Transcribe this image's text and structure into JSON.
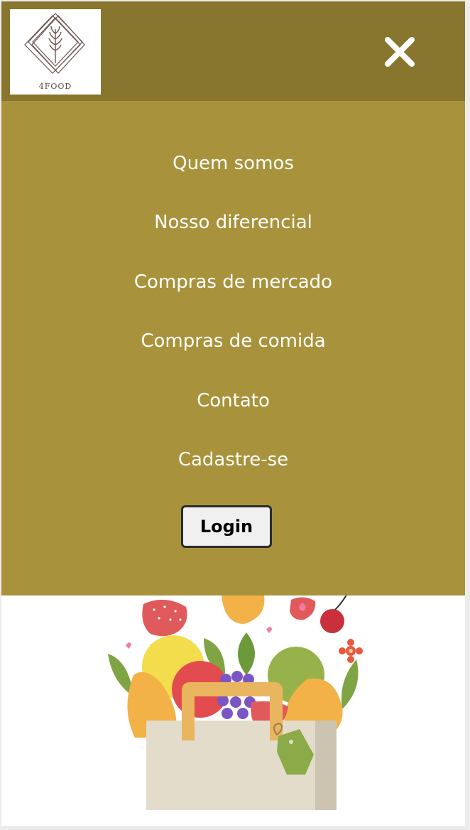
{
  "header": {
    "logo_text": "4FOOD",
    "logo_icon": "diamond-wheat-icon",
    "close_icon": "close-icon",
    "background": "#88752e"
  },
  "menu": {
    "background": "#a8923b",
    "items": [
      {
        "label": "Quem somos"
      },
      {
        "label": "Nosso diferencial"
      },
      {
        "label": "Compras de mercado"
      },
      {
        "label": "Compras de comida"
      },
      {
        "label": "Contato"
      },
      {
        "label": "Cadastre-se"
      }
    ],
    "login_label": "Login"
  },
  "hero": {
    "image": "grocery-bag-illustration"
  }
}
